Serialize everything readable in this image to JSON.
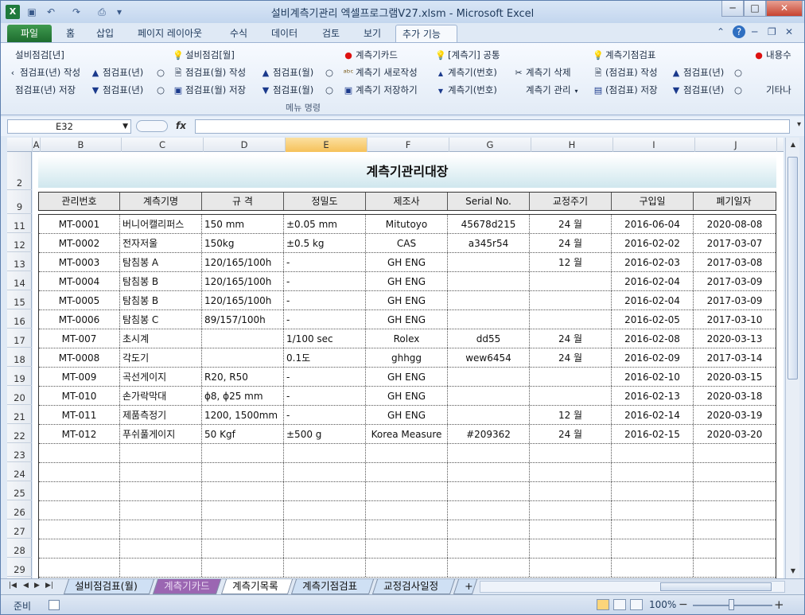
{
  "window": {
    "title": "설비계측기관리 엑셀프로그램V27.xlsm - Microsoft Excel",
    "app_icon_label": "X",
    "quick_access": [
      "save-icon",
      "undo-icon",
      "redo-icon",
      "print-preview-icon",
      "customize-icon"
    ],
    "controls": {
      "minimize": "─",
      "maximize": "□",
      "close": "✕"
    }
  },
  "ribbon_tabs": [
    "파일",
    "홈",
    "삽입",
    "페이지 레이아웃",
    "수식",
    "데이터",
    "검토",
    "보기",
    "추가 기능"
  ],
  "ribbon_tab_active": "추가 기능",
  "ribbon": {
    "group_label": "메뉴 명령",
    "items": [
      {
        "label": "설비점검[년]",
        "icon": ""
      },
      {
        "label": "점검표(년) 작성",
        "icon": "‹"
      },
      {
        "label": "점검표(년) 저장",
        "icon": ""
      },
      {
        "label": "점검표(년)",
        "icon": "▲"
      },
      {
        "label": "점검표(년)",
        "icon": "▼"
      },
      {
        "label": "설비점검[월]",
        "icon": "bulb"
      },
      {
        "label": "점검표(월) 작성",
        "icon": "doc"
      },
      {
        "label": "점검표(월) 저장",
        "icon": "save"
      },
      {
        "label": "점검표(월)",
        "icon": "▲"
      },
      {
        "label": "점검표(월)",
        "icon": "▼"
      },
      {
        "label": "계측기카드",
        "icon": "bulb-red"
      },
      {
        "label": "계측기 새로작성",
        "icon": "abc"
      },
      {
        "label": "계측기 저장하기",
        "icon": "save"
      },
      {
        "label": "[계측기] 공통",
        "icon": "bulb"
      },
      {
        "label": "계측기(번호)",
        "icon": "▲"
      },
      {
        "label": "계측기(번호)",
        "icon": "▼"
      },
      {
        "label": "계측기 삭제",
        "icon": "scissors"
      },
      {
        "label": "계측기 관리",
        "icon": ""
      },
      {
        "label": "계측기점검표",
        "icon": "bulb"
      },
      {
        "label": "(점검표) 작성",
        "icon": "doc"
      },
      {
        "label": "(점검표) 저장",
        "icon": "save"
      },
      {
        "label": "점검표(년)",
        "icon": "▲"
      },
      {
        "label": "점검표(년)",
        "icon": "▼"
      },
      {
        "label": "내용수",
        "icon": "bulb-red"
      },
      {
        "label": "기타나",
        "icon": ""
      }
    ]
  },
  "formula_bar": {
    "name_box": "E32",
    "fx": "fx",
    "formula": ""
  },
  "columns": [
    "A",
    "B",
    "C",
    "D",
    "E",
    "F",
    "G",
    "H",
    "I",
    "J"
  ],
  "selected_column": "E",
  "row_numbers": [
    "2",
    "9",
    "11",
    "12",
    "13",
    "14",
    "15",
    "16",
    "17",
    "18",
    "19",
    "20",
    "21",
    "22",
    "23",
    "24",
    "25",
    "26",
    "27",
    "28",
    "29"
  ],
  "sheet": {
    "title": "계측기관리대장",
    "headers": [
      "관리번호",
      "계측기명",
      "규  격",
      "정밀도",
      "제조사",
      "Serial No.",
      "교정주기",
      "구입일",
      "폐기일자"
    ],
    "rows": [
      [
        "MT-0001",
        "버니어캘리퍼스",
        "150 mm",
        "±0.05 mm",
        "Mitutoyo",
        "45678d215",
        "24 월",
        "2016-06-04",
        "2020-08-08"
      ],
      [
        "MT-0002",
        "전자저울",
        "150kg",
        "±0.5 kg",
        "CAS",
        "a345r54",
        "24 월",
        "2016-02-02",
        "2017-03-07"
      ],
      [
        "MT-0003",
        "탐침봉 A",
        "120/165/100h",
        "-",
        "GH ENG",
        "",
        "12 월",
        "2016-02-03",
        "2017-03-08"
      ],
      [
        "MT-0004",
        "탐침봉 B",
        "120/165/100h",
        "-",
        "GH ENG",
        "",
        "",
        "2016-02-04",
        "2017-03-09"
      ],
      [
        "MT-0005",
        "탐침봉 B",
        "120/165/100h",
        "-",
        "GH ENG",
        "",
        "",
        "2016-02-04",
        "2017-03-09"
      ],
      [
        "MT-0006",
        "탐침봉 C",
        "89/157/100h",
        "-",
        "GH ENG",
        "",
        "",
        "2016-02-05",
        "2017-03-10"
      ],
      [
        "MT-007",
        "초시계",
        "",
        "1/100 sec",
        "Rolex",
        "dd55",
        "24 월",
        "2016-02-08",
        "2020-03-13"
      ],
      [
        "MT-0008",
        "각도기",
        "",
        "0.1도",
        "ghhgg",
        "wew6454",
        "24 월",
        "2016-02-09",
        "2017-03-14"
      ],
      [
        "MT-009",
        "곡선게이지",
        "R20, R50",
        "-",
        "GH ENG",
        "",
        "",
        "2016-02-10",
        "2020-03-15"
      ],
      [
        "MT-010",
        "손가락막대",
        "ϕ8, ϕ25 mm",
        "-",
        "GH ENG",
        "",
        "",
        "2016-02-13",
        "2020-03-18"
      ],
      [
        "MT-011",
        "제품측정기",
        "1200, 1500mm",
        "-",
        "GH ENG",
        "",
        "12 월",
        "2016-02-14",
        "2020-03-19"
      ],
      [
        "MT-012",
        "푸쉬풀게이지",
        "50 Kgf",
        "±500 g",
        "Korea Measure",
        "#209362",
        "24 월",
        "2016-02-15",
        "2020-03-20"
      ]
    ],
    "empty_rows": 7
  },
  "sheet_tabs": [
    "설비점검표(월)",
    "계측기카드",
    "계측기목록",
    "계측기점검표",
    "교정검사일정",
    "+"
  ],
  "active_sheet_tab": "계측기목록",
  "status_bar": {
    "ready": "준비",
    "zoom": "100%",
    "zoom_minus": "−",
    "zoom_plus": "+"
  }
}
